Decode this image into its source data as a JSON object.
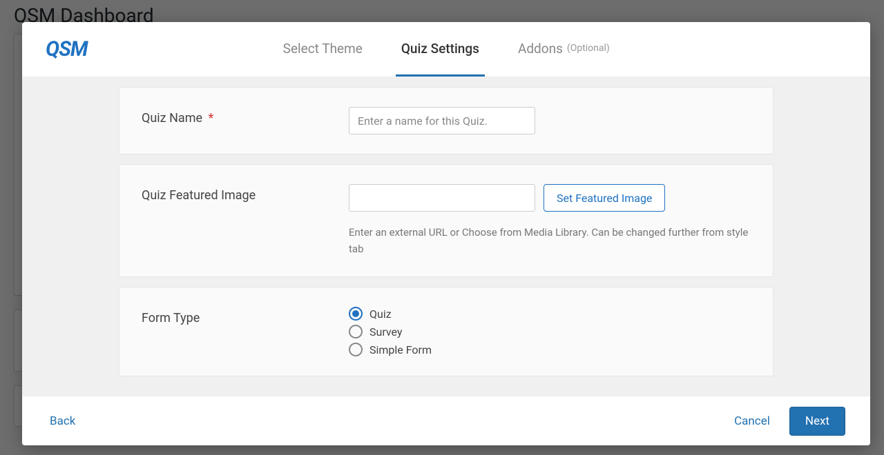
{
  "background": {
    "page_title": "QSM Dashboard"
  },
  "modal": {
    "logo_text": "QSM",
    "tabs": [
      {
        "label": "Select Theme",
        "optional": "",
        "active": false
      },
      {
        "label": "Quiz Settings",
        "optional": "",
        "active": true
      },
      {
        "label": "Addons",
        "optional": "(Optional)",
        "active": false
      }
    ],
    "quiz_name": {
      "label": "Quiz Name",
      "required_marker": "*",
      "placeholder": "Enter a name for this Quiz.",
      "value": ""
    },
    "featured_image": {
      "label": "Quiz Featured Image",
      "value": "",
      "button": "Set Featured Image",
      "help": "Enter an external URL or Choose from Media Library. Can be changed further from style tab"
    },
    "form_type": {
      "label": "Form Type",
      "options": [
        {
          "label": "Quiz",
          "checked": true
        },
        {
          "label": "Survey",
          "checked": false
        },
        {
          "label": "Simple Form",
          "checked": false
        }
      ]
    },
    "footer": {
      "back": "Back",
      "cancel": "Cancel",
      "next": "Next"
    }
  }
}
